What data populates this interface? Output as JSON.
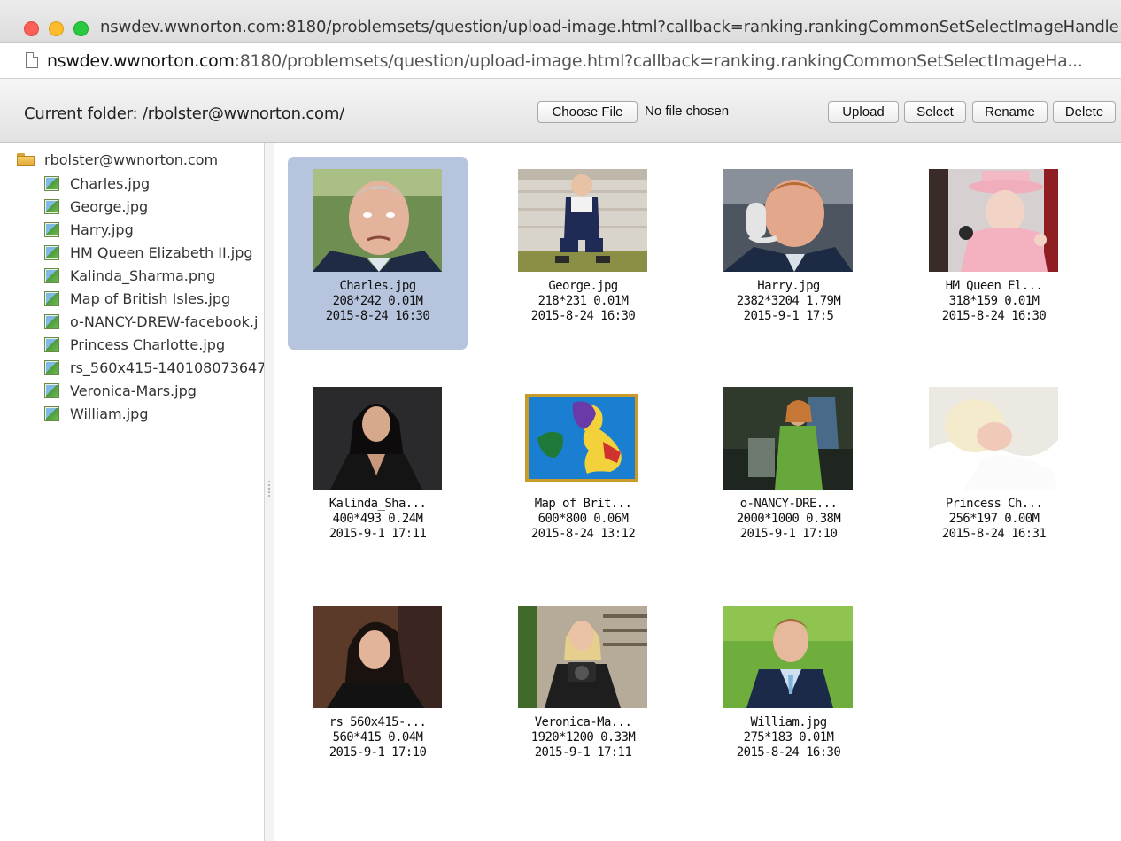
{
  "window": {
    "title": "nswdev.wwnorton.com:8180/problemsets/question/upload-image.html?callback=ranking.rankingCommonSetSelectImageHandle",
    "url_host": "nswdev.wwnorton.com",
    "url_rest": ":8180/problemsets/question/upload-image.html?callback=ranking.rankingCommonSetSelectImageHa..."
  },
  "toolbar": {
    "folder_label": "Current folder: /rbolster@wwnorton.com/",
    "choose_file_label": "Choose File",
    "file_status": "No file chosen",
    "upload_label": "Upload",
    "select_label": "Select",
    "rename_label": "Rename",
    "delete_label": "Delete"
  },
  "tree": {
    "root_label": "rbolster@wwnorton.com",
    "items": [
      {
        "label": "Charles.jpg"
      },
      {
        "label": "George.jpg"
      },
      {
        "label": "Harry.jpg"
      },
      {
        "label": "HM Queen Elizabeth II.jpg"
      },
      {
        "label": "Kalinda_Sharma.png"
      },
      {
        "label": "Map of British Isles.jpg"
      },
      {
        "label": "o-NANCY-DREW-facebook.j"
      },
      {
        "label": "Princess Charlotte.jpg"
      },
      {
        "label": "rs_560x415-140108073647"
      },
      {
        "label": "Veronica-Mars.jpg"
      },
      {
        "label": "William.jpg"
      }
    ]
  },
  "files": [
    {
      "name": "Charles.jpg",
      "info": "208*242 0.01M",
      "date": "2015-8-24 16:30",
      "selected": true
    },
    {
      "name": "George.jpg",
      "info": "218*231 0.01M",
      "date": "2015-8-24 16:30"
    },
    {
      "name": "Harry.jpg",
      "info": "2382*3204 1.79M",
      "date": "2015-9-1 17:5"
    },
    {
      "name": "HM Queen El...",
      "info": "318*159 0.01M",
      "date": "2015-8-24 16:30"
    },
    {
      "name": "Kalinda_Sha...",
      "info": "400*493 0.24M",
      "date": "2015-9-1 17:11"
    },
    {
      "name": "Map of Brit...",
      "info": "600*800 0.06M",
      "date": "2015-8-24 13:12"
    },
    {
      "name": "o-NANCY-DRE...",
      "info": "2000*1000 0.38M",
      "date": "2015-9-1 17:10"
    },
    {
      "name": "Princess Ch...",
      "info": "256*197 0.00M",
      "date": "2015-8-24 16:31"
    },
    {
      "name": "rs_560x415-...",
      "info": "560*415 0.04M",
      "date": "2015-9-1 17:10"
    },
    {
      "name": "Veronica-Ma...",
      "info": "1920*1200 0.33M",
      "date": "2015-9-1 17:11"
    },
    {
      "name": "William.jpg",
      "info": "275*183 0.01M",
      "date": "2015-8-24 16:30"
    }
  ],
  "colors": {
    "selection": "#b7c4dd",
    "close": "#fc5f57",
    "minimize": "#fdbc2e",
    "zoom": "#28c840"
  }
}
